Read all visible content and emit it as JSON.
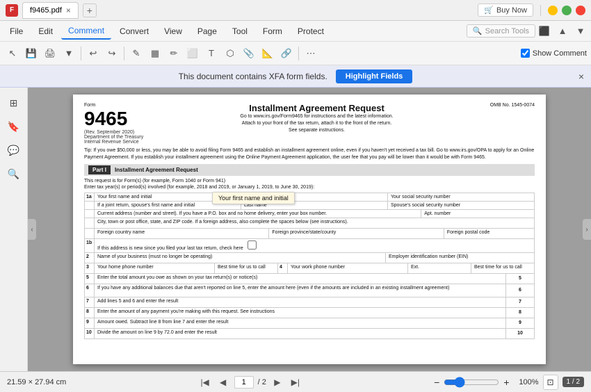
{
  "titlebar": {
    "app_icon": "F",
    "file_name": "f9465.pdf",
    "tab_close": "×",
    "tab_add": "+",
    "buy_now": "Buy Now",
    "minimize": "—",
    "restore": "❐",
    "close": "✕"
  },
  "menubar": {
    "items": [
      {
        "id": "file",
        "label": "File"
      },
      {
        "id": "edit",
        "label": "Edit"
      },
      {
        "id": "comment",
        "label": "Comment",
        "active": true
      },
      {
        "id": "convert",
        "label": "Convert"
      },
      {
        "id": "view",
        "label": "View"
      },
      {
        "id": "page",
        "label": "Page"
      },
      {
        "id": "tool",
        "label": "Tool"
      },
      {
        "id": "form",
        "label": "Form"
      },
      {
        "id": "protect",
        "label": "Protect"
      }
    ],
    "search_placeholder": "Search Tools"
  },
  "toolbar": {
    "show_comment_label": "Show Comment"
  },
  "xfa_banner": {
    "message": "This document contains XFA form fields.",
    "highlight_button": "Highlight Fields",
    "close": "×"
  },
  "pdf": {
    "form_number": "9465",
    "form_label": "Form",
    "rev_date": "(Rev. September 2020)",
    "dept": "Department of the Treasury",
    "irs": "Internal Revenue Service",
    "title": "Installment Agreement Request",
    "instructions_line1": "Go to www.irs.gov/Form9465 for instructions and the latest information.",
    "instructions_line2": "Attach to your front of the tax return, attach it to the front of the return.",
    "instructions_line3": "See separate instructions.",
    "omb": "OMB No. 1545-0074",
    "tip_text": "Tip: If you owe $50,000 or less, you may be able to avoid filing Form 9465 and establish an installment agreement online, even if you haven't yet received a tax bill. Go to www.irs.gov/OPA to apply for an Online Payment Agreement. If you establish your installment agreement using the Online Payment Agreement application, the user fee that you pay will be lower than it would be with Form 9465.",
    "part_i_label": "Part I",
    "part_i_title": "Installment Agreement Request",
    "request_desc": "This request is for Form(s) (for example, Form 1040 or Form 941)",
    "tax_year_desc": "Enter tax year(s) or period(s) involved (for example, 2018 and 2019, or January 1, 2019, to June 30, 2019):",
    "row_1a_label": "1a",
    "row_1a_first": "Your first name and initial",
    "row_1a_last": "Last name",
    "row_1a_ssn": "Your social security number",
    "row_joint_first": "If a joint return, spouse's first name and initial",
    "row_joint_last": "Last name",
    "row_joint_ssn": "Spouse's social security number",
    "hint_text": "Your first name and initial",
    "row_address": "Current address (number and street). If you have a P.O. box and no home delivery, enter your box number.",
    "row_apt": "Apt. number",
    "row_city": "City, town or post office, state, and ZIP code. If a foreign address, also complete the spaces below (see instructions).",
    "row_country": "Foreign country name",
    "row_province": "Foreign province/state/county",
    "row_postal": "Foreign postal code",
    "row_1b_label": "1b",
    "row_1b_text": "If this address is new since you filed your last tax return, check here",
    "row_2_label": "2",
    "row_2_text": "Name of your business (must no longer be operating)",
    "row_2_ein": "Employer identification number (EIN)",
    "row_3_label": "3",
    "row_phone_home": "Your home phone number",
    "row_phone_best": "Best time for us to call",
    "row_4_label": "4",
    "row_phone_work": "Your work phone number",
    "row_phone_ext": "Ext.",
    "row_phone_best2": "Best time for us to call",
    "row_5_label": "5",
    "row_5_text": "Enter the total amount you owe as shown on your tax return(s) or notice(s)",
    "row_6_label": "6",
    "row_6_text": "If you have any additional balances due that aren't reported on line 5, enter the amount here (even if the amounts are included in an existing installment agreement)",
    "row_7_label": "7",
    "row_7_text": "Add lines 5 and 6 and enter the result",
    "row_8_label": "8",
    "row_8_text": "Enter the amount of any payment you're making with this request. See instructions",
    "row_9_label": "9",
    "row_9_text": "Amount owed. Subtract line 8 from line 7 and enter the result",
    "row_10_label": "10",
    "row_10_text": "Divide the amount on line 9 by 72.0 and enter the result"
  },
  "bottombar": {
    "page_size": "21.59 × 27.94 cm",
    "page_current": "1",
    "page_total": "/ 2",
    "zoom_percent": "100%",
    "page_badge": "1 / 2"
  }
}
